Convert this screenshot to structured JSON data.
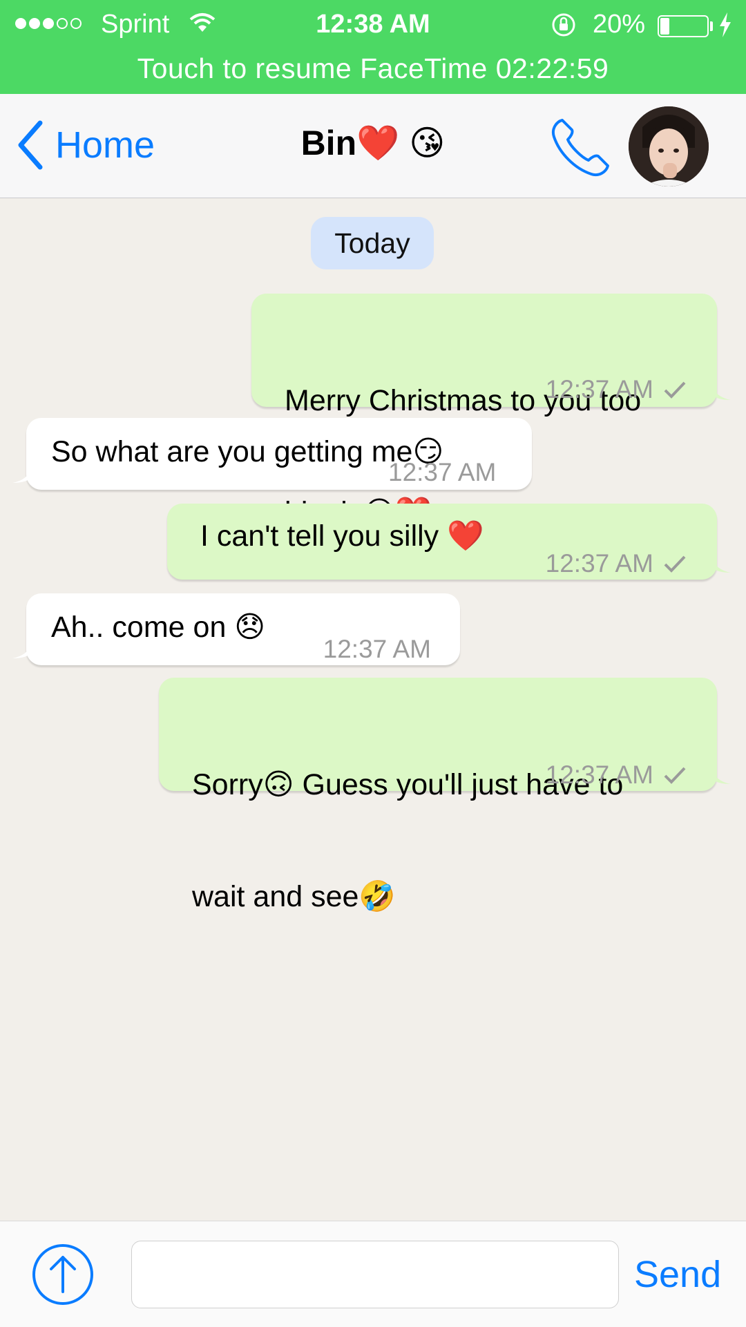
{
  "status_bar": {
    "carrier": "Sprint",
    "signal_bars_filled": 3,
    "signal_bars_total": 5,
    "time": "12:38 AM",
    "battery_percent_label": "20%",
    "battery_level": 0.2,
    "banner": "Touch to resume FaceTime 02:22:59",
    "color": "#4cd964"
  },
  "nav": {
    "back_label": "Home",
    "title": "Bin❤️ 😘",
    "accent_color": "#0a7cff",
    "icons": [
      "chevron-left-icon",
      "phone-icon"
    ]
  },
  "chat": {
    "date_label": "Today",
    "messages": [
      {
        "direction": "outgoing",
        "text_line1": "Merry Christmas to you too",
        "text_line2": "binnie😘❤️",
        "time": "12:37 AM",
        "status": "sent-check"
      },
      {
        "direction": "incoming",
        "text": "So what are you getting me😏",
        "time": "12:37 AM"
      },
      {
        "direction": "outgoing",
        "text": "I can't tell you silly ❤️",
        "time": "12:37 AM",
        "status": "sent-check"
      },
      {
        "direction": "incoming",
        "text": "Ah.. come on 😞",
        "time": "12:37 AM"
      },
      {
        "direction": "outgoing",
        "text_line1": "Sorry🙃 Guess you'll just have to",
        "text_line2": "wait and see🤣",
        "time": "12:37 AM",
        "status": "sent-check"
      }
    ],
    "outgoing_color": "#dcf8c6",
    "incoming_color": "#ffffff"
  },
  "input_bar": {
    "value": "",
    "placeholder": "",
    "send_label": "Send",
    "attach_icon": "upload-arrow-icon"
  }
}
